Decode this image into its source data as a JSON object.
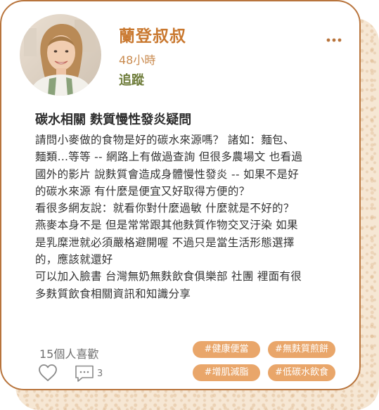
{
  "post": {
    "author_name": "蘭登叔叔",
    "time_ago": "48小時",
    "follow_label": "追蹤",
    "title": "碳水相關 麩質慢性發炎疑問",
    "body_lines": [
      "請問小麥做的食物是好的碳水來源嗎？ 諸如：麵包、",
      "麵類...等等 -- 網路上有做過查詢 但很多農場文 也看過",
      "國外的影片 說麩質會造成身體慢性發炎 -- 如果不是好",
      "的碳水來源 有什麼是便宜又好取得方便的？",
      "看很多網友說：就看你對什麼過敏 什麼就是不好的？",
      "燕麥本身不是 但是常常跟其他麩質作物交叉汙染 如果",
      "是乳糜泄就必須嚴格避開喔 不過只是當生活形態選擇",
      "的，應該就還好",
      "可以加入臉書 台灣無奶無麩飲食俱樂部 社團 裡面有很",
      "多麩質飲食相關資訊和知識分享"
    ],
    "likes_text": "15個人喜歡",
    "comment_count": "3",
    "tags": [
      "#健康便當",
      "#無麩質煎餅",
      "#增肌減脂",
      "#低碳水飲食"
    ]
  },
  "icons": {
    "more": "more-horizontal-icon",
    "like": "heart-icon",
    "comment": "comment-bubble-icon"
  },
  "colors": {
    "accent": "#c9782f",
    "follow": "#6e7c3a",
    "tag_bg": "#e9a66a",
    "border": "#b8743c",
    "backdrop": "#f6e7d4"
  }
}
